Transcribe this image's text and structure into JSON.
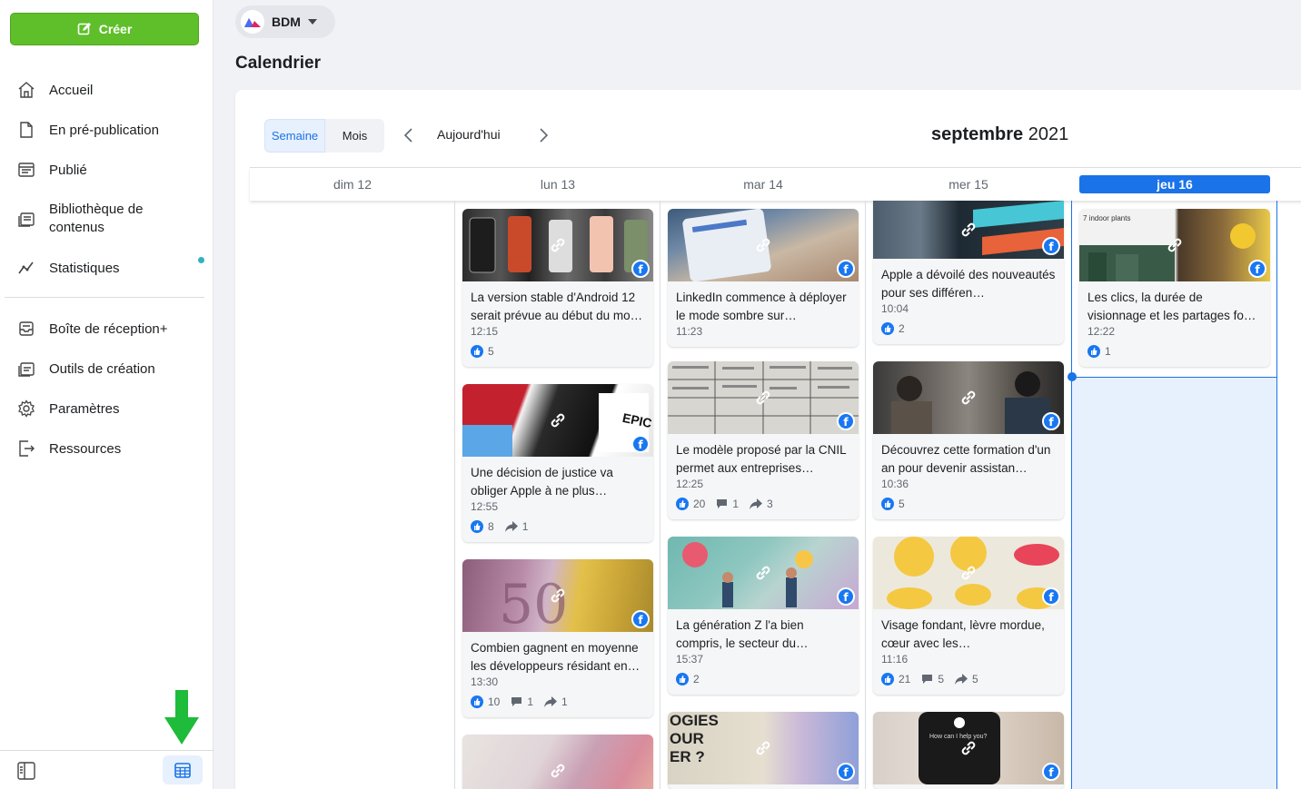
{
  "sidebar": {
    "create_label": "Créer",
    "items": [
      {
        "label": "Accueil",
        "icon": "home-icon"
      },
      {
        "label": "En pré-publication",
        "icon": "draft-icon"
      },
      {
        "label": "Publié",
        "icon": "published-icon"
      },
      {
        "label": "Bibliothèque de contenus",
        "icon": "library-icon"
      },
      {
        "label": "Statistiques",
        "icon": "stats-icon"
      },
      {
        "label": "Boîte de réception+",
        "icon": "inbox-icon"
      },
      {
        "label": "Outils de création",
        "icon": "tools-icon"
      },
      {
        "label": "Paramètres",
        "icon": "settings-icon"
      },
      {
        "label": "Ressources",
        "icon": "resources-icon"
      }
    ]
  },
  "header": {
    "account_name": "BDM",
    "page_title": "Calendrier"
  },
  "toolbar": {
    "week_label": "Semaine",
    "month_label": "Mois",
    "today_label": "Aujourd'hui",
    "month_name": "septembre",
    "year": "2021"
  },
  "days": [
    {
      "label": "dim 12"
    },
    {
      "label": "lun 13"
    },
    {
      "label": "mar 14"
    },
    {
      "label": "mer 15"
    },
    {
      "label": "jeu 16"
    }
  ],
  "colors": {
    "accent": "#1a73e8",
    "create_green": "#5fbf2a",
    "facebook": "#1877f2"
  },
  "posts": {
    "lun": [
      {
        "text": "La version stable d'Android 12 serait prévue au début du mo…",
        "time": "12:15",
        "likes": "5"
      },
      {
        "text": "Une décision de justice va obliger Apple à ne plus…",
        "time": "12:55",
        "likes": "8",
        "shares": "1"
      },
      {
        "text": "Combien gagnent en moyenne les développeurs résidant en…",
        "time": "13:30",
        "likes": "10",
        "comments": "1",
        "shares": "1"
      }
    ],
    "mar": [
      {
        "text": "LinkedIn commence à déployer le mode sombre sur…",
        "time": "11:23"
      },
      {
        "text": "Le modèle proposé par la CNIL permet aux entreprises…",
        "time": "12:25",
        "likes": "20",
        "comments": "1",
        "shares": "3"
      },
      {
        "text": "La génération Z l'a bien compris, le secteur du…",
        "time": "15:37",
        "likes": "2"
      }
    ],
    "mer": [
      {
        "text": "Apple a dévoilé des nouveautés pour ses différen…",
        "time": "10:04",
        "likes": "2"
      },
      {
        "text": "Découvrez cette formation d'un an pour devenir assistan…",
        "time": "10:36",
        "likes": "5"
      },
      {
        "text": "Visage fondant, lèvre mordue, cœur avec les…",
        "time": "11:16",
        "likes": "21",
        "comments": "5",
        "shares": "5"
      }
    ],
    "jeu": [
      {
        "text": "Les clics, la durée de visionnage et les partages fo…",
        "time": "12:22",
        "likes": "1"
      }
    ]
  },
  "thumb_texts": {
    "epic": "EPIC",
    "indoor": "7 indoor plants",
    "ogies": "OGIES\nOUR\nER ?",
    "help": "How can I help you?"
  }
}
